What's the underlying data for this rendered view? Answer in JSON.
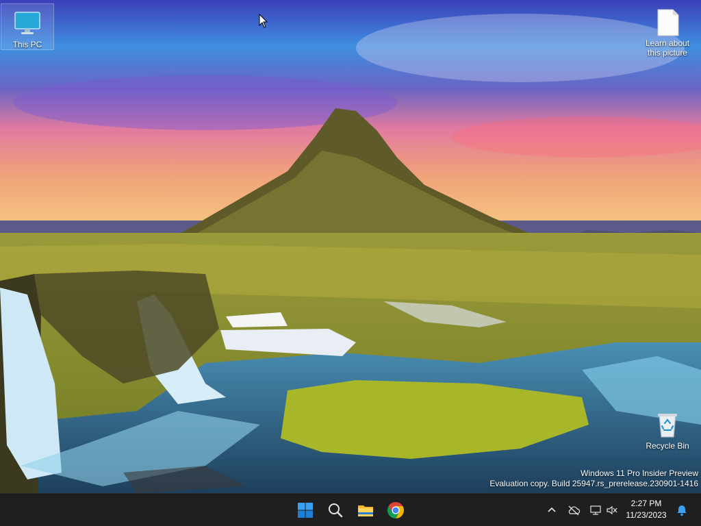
{
  "desktop": {
    "icons": [
      {
        "label": "This PC",
        "icon": "monitor-icon"
      },
      {
        "label": "Learn about this picture",
        "icon": "document-icon"
      },
      {
        "label": "Recycle Bin",
        "icon": "recycle-bin-icon"
      }
    ],
    "watermark": {
      "line1": "Windows 11 Pro Insider Preview",
      "line2": "Evaluation copy. Build 25947.rs_prerelease.230901-1416"
    }
  },
  "taskbar": {
    "pinned": [
      {
        "name": "start",
        "icon": "windows-logo-icon"
      },
      {
        "name": "search",
        "icon": "search-icon"
      },
      {
        "name": "file-explorer",
        "icon": "folder-icon"
      },
      {
        "name": "chrome",
        "icon": "chrome-icon"
      }
    ],
    "tray": [
      {
        "name": "show-hidden-icons",
        "icon": "chevron-up-icon"
      },
      {
        "name": "onedrive",
        "icon": "cloud-off-icon"
      },
      {
        "name": "network",
        "icon": "network-icon"
      },
      {
        "name": "volume",
        "icon": "volume-muted-icon"
      }
    ],
    "clock": {
      "time": "2:27 PM",
      "date": "11/23/2023"
    },
    "notifications": {
      "icon": "bell-icon"
    }
  },
  "colors": {
    "taskbar": "#1f1f1f",
    "accent": "#0078d4"
  }
}
